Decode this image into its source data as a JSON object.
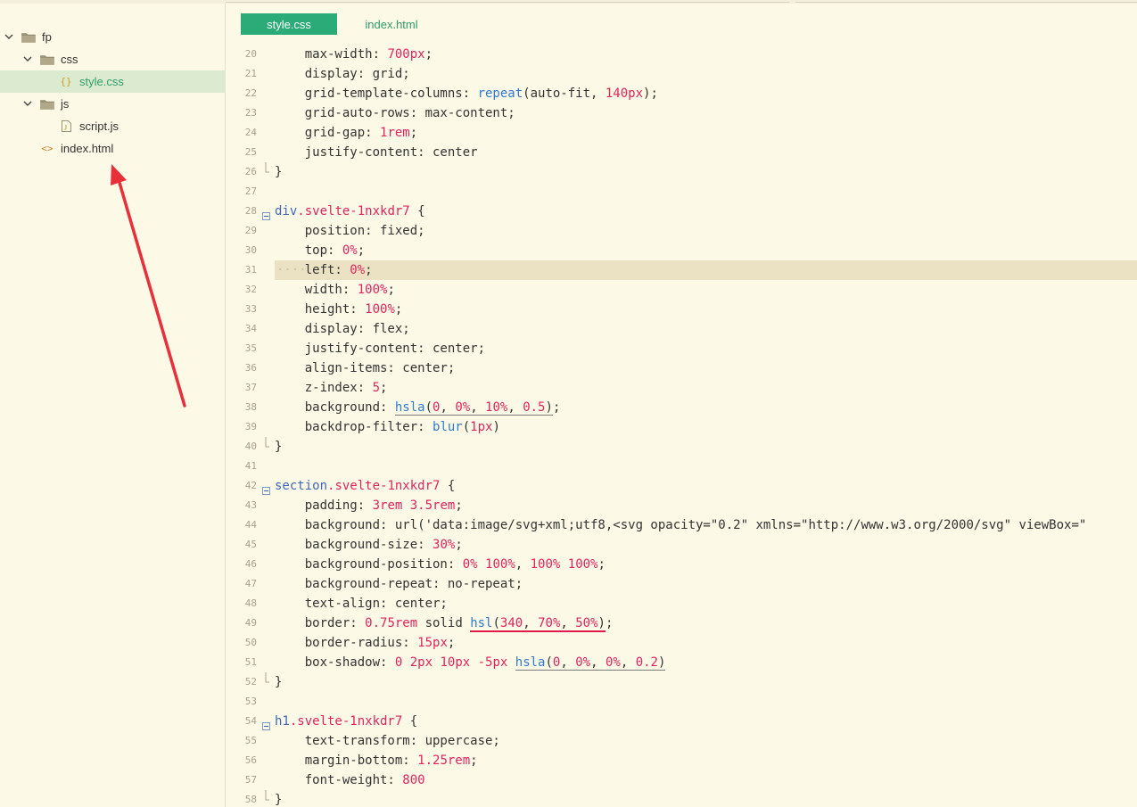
{
  "sidebar": {
    "items": [
      {
        "label": "fp",
        "kind": "folder",
        "expanded": true,
        "depth": 0,
        "selected": false
      },
      {
        "label": "css",
        "kind": "folder",
        "expanded": true,
        "depth": 1,
        "selected": false
      },
      {
        "label": "style.css",
        "kind": "css-file",
        "icon": "{}",
        "depth": 2,
        "selected": true
      },
      {
        "label": "js",
        "kind": "folder",
        "expanded": true,
        "depth": 1,
        "selected": false
      },
      {
        "label": "script.js",
        "kind": "js-file",
        "depth": 2,
        "selected": false
      },
      {
        "label": "index.html",
        "kind": "html-file",
        "icon": "<>",
        "depth": 1,
        "selected": false
      }
    ]
  },
  "tabs": [
    {
      "label": "style.css",
      "active": true
    },
    {
      "label": "index.html",
      "active": false
    }
  ],
  "colors": {
    "accent": "#2bab77",
    "selection_bg": "#dcebd0",
    "current_line": "#ebe1c3",
    "annotation_arrow": "#e8303a",
    "keyword_number": "#e0245e",
    "selector": "#3f67b9",
    "function": "#2f7bcf"
  },
  "editor": {
    "current_line": 31,
    "lines": [
      {
        "n": 20,
        "fold": "",
        "tokens": [
          [
            "    max-width: ",
            "p"
          ],
          [
            "700",
            "n"
          ],
          [
            "px",
            "n"
          ],
          [
            ";",
            "p"
          ]
        ]
      },
      {
        "n": 21,
        "fold": "",
        "tokens": [
          [
            "    display: grid;",
            "p"
          ]
        ]
      },
      {
        "n": 22,
        "fold": "",
        "tokens": [
          [
            "    grid-template-columns: ",
            "p"
          ],
          [
            "repeat",
            "f"
          ],
          [
            "(auto-fit, ",
            "p"
          ],
          [
            "140",
            "n"
          ],
          [
            "px",
            "n"
          ],
          [
            ");",
            "p"
          ]
        ]
      },
      {
        "n": 23,
        "fold": "",
        "tokens": [
          [
            "    grid-auto-rows: max-content;",
            "p"
          ]
        ]
      },
      {
        "n": 24,
        "fold": "",
        "tokens": [
          [
            "    grid-gap: ",
            "p"
          ],
          [
            "1",
            "n"
          ],
          [
            "rem",
            "n"
          ],
          [
            ";",
            "p"
          ]
        ]
      },
      {
        "n": 25,
        "fold": "",
        "tokens": [
          [
            "    justify-content: center",
            "p"
          ]
        ]
      },
      {
        "n": 26,
        "fold": "end",
        "tokens": [
          [
            "}",
            "p"
          ]
        ]
      },
      {
        "n": 27,
        "fold": "",
        "tokens": []
      },
      {
        "n": 28,
        "fold": "start",
        "tokens": [
          [
            "div",
            "s"
          ],
          [
            ".svelte-1nxkdr7",
            "c"
          ],
          [
            " {",
            "p"
          ]
        ]
      },
      {
        "n": 29,
        "fold": "",
        "tokens": [
          [
            "    position: fixed;",
            "p"
          ]
        ]
      },
      {
        "n": 30,
        "fold": "",
        "tokens": [
          [
            "    top: ",
            "p"
          ],
          [
            "0",
            "n"
          ],
          [
            "%",
            "n"
          ],
          [
            ";",
            "p"
          ]
        ]
      },
      {
        "n": 31,
        "fold": "",
        "tokens": [
          [
            "    left: ",
            "p"
          ],
          [
            "0",
            "n"
          ],
          [
            "%",
            "n"
          ],
          [
            ";",
            "p"
          ]
        ]
      },
      {
        "n": 32,
        "fold": "",
        "tokens": [
          [
            "    width: ",
            "p"
          ],
          [
            "100",
            "n"
          ],
          [
            "%",
            "n"
          ],
          [
            ";",
            "p"
          ]
        ]
      },
      {
        "n": 33,
        "fold": "",
        "tokens": [
          [
            "    height: ",
            "p"
          ],
          [
            "100",
            "n"
          ],
          [
            "%",
            "n"
          ],
          [
            ";",
            "p"
          ]
        ]
      },
      {
        "n": 34,
        "fold": "",
        "tokens": [
          [
            "    display: flex;",
            "p"
          ]
        ]
      },
      {
        "n": 35,
        "fold": "",
        "tokens": [
          [
            "    justify-content: center;",
            "p"
          ]
        ]
      },
      {
        "n": 36,
        "fold": "",
        "tokens": [
          [
            "    align-items: center;",
            "p"
          ]
        ]
      },
      {
        "n": 37,
        "fold": "",
        "tokens": [
          [
            "    z-index: ",
            "p"
          ],
          [
            "5",
            "n"
          ],
          [
            ";",
            "p"
          ]
        ]
      },
      {
        "n": 38,
        "fold": "",
        "tokens": [
          [
            "    background: ",
            "p"
          ],
          [
            "hsla",
            "fu"
          ],
          [
            "(",
            "pu"
          ],
          [
            "0",
            "nu"
          ],
          [
            ", ",
            "pu"
          ],
          [
            "0",
            "nu"
          ],
          [
            "%",
            "nu"
          ],
          [
            ", ",
            "pu"
          ],
          [
            "10",
            "nu"
          ],
          [
            "%",
            "nu"
          ],
          [
            ", ",
            "pu"
          ],
          [
            "0.5",
            "nu"
          ],
          [
            ")",
            "pu"
          ],
          [
            ";",
            "p"
          ]
        ]
      },
      {
        "n": 39,
        "fold": "",
        "tokens": [
          [
            "    backdrop-filter: ",
            "p"
          ],
          [
            "blur",
            "f"
          ],
          [
            "(",
            "p"
          ],
          [
            "1",
            "n"
          ],
          [
            "px",
            "n"
          ],
          [
            ")",
            "p"
          ]
        ]
      },
      {
        "n": 40,
        "fold": "end",
        "tokens": [
          [
            "}",
            "p"
          ]
        ]
      },
      {
        "n": 41,
        "fold": "",
        "tokens": []
      },
      {
        "n": 42,
        "fold": "start",
        "tokens": [
          [
            "section",
            "s"
          ],
          [
            ".svelte-1nxkdr7",
            "c"
          ],
          [
            " {",
            "p"
          ]
        ]
      },
      {
        "n": 43,
        "fold": "",
        "tokens": [
          [
            "    padding: ",
            "p"
          ],
          [
            "3",
            "n"
          ],
          [
            "rem ",
            "n"
          ],
          [
            "3.5",
            "n"
          ],
          [
            "rem",
            "n"
          ],
          [
            ";",
            "p"
          ]
        ]
      },
      {
        "n": 44,
        "fold": "",
        "tokens": [
          [
            "    background: url('data:image/svg+xml;utf8,<svg opacity=\"0.2\" xmlns=\"http://www.w3.org/2000/svg\" viewBox=\"",
            "p"
          ]
        ]
      },
      {
        "n": 45,
        "fold": "",
        "tokens": [
          [
            "    background-size: ",
            "p"
          ],
          [
            "30",
            "n"
          ],
          [
            "%",
            "n"
          ],
          [
            ";",
            "p"
          ]
        ]
      },
      {
        "n": 46,
        "fold": "",
        "tokens": [
          [
            "    background-position: ",
            "p"
          ],
          [
            "0",
            "n"
          ],
          [
            "% ",
            "n"
          ],
          [
            "100",
            "n"
          ],
          [
            "%",
            "n"
          ],
          [
            ", ",
            "p"
          ],
          [
            "100",
            "n"
          ],
          [
            "% ",
            "n"
          ],
          [
            "100",
            "n"
          ],
          [
            "%",
            "n"
          ],
          [
            ";",
            "p"
          ]
        ]
      },
      {
        "n": 47,
        "fold": "",
        "tokens": [
          [
            "    background-repeat: no-repeat;",
            "p"
          ]
        ]
      },
      {
        "n": 48,
        "fold": "",
        "tokens": [
          [
            "    text-align: center;",
            "p"
          ]
        ]
      },
      {
        "n": 49,
        "fold": "",
        "tokens": [
          [
            "    border: ",
            "p"
          ],
          [
            "0.75",
            "n"
          ],
          [
            "rem",
            "n"
          ],
          [
            " solid ",
            "p"
          ],
          [
            "hsl",
            "fr"
          ],
          [
            "(",
            "pr"
          ],
          [
            "340",
            "nr"
          ],
          [
            ", ",
            "pr"
          ],
          [
            "70",
            "nr"
          ],
          [
            "%",
            "nr"
          ],
          [
            ", ",
            "pr"
          ],
          [
            "50",
            "nr"
          ],
          [
            "%",
            "nr"
          ],
          [
            ")",
            "pr"
          ],
          [
            ";",
            "p"
          ]
        ]
      },
      {
        "n": 50,
        "fold": "",
        "tokens": [
          [
            "    border-radius: ",
            "p"
          ],
          [
            "15",
            "n"
          ],
          [
            "px",
            "n"
          ],
          [
            ";",
            "p"
          ]
        ]
      },
      {
        "n": 51,
        "fold": "",
        "tokens": [
          [
            "    box-shadow: ",
            "p"
          ],
          [
            "0 ",
            "n"
          ],
          [
            "2",
            "n"
          ],
          [
            "px ",
            "n"
          ],
          [
            "10",
            "n"
          ],
          [
            "px ",
            "n"
          ],
          [
            "-5",
            "n"
          ],
          [
            "px ",
            "n"
          ],
          [
            "hsla",
            "fu"
          ],
          [
            "(",
            "pu"
          ],
          [
            "0",
            "nu"
          ],
          [
            ", ",
            "pu"
          ],
          [
            "0",
            "nu"
          ],
          [
            "%",
            "nu"
          ],
          [
            ", ",
            "pu"
          ],
          [
            "0",
            "nu"
          ],
          [
            "%",
            "nu"
          ],
          [
            ", ",
            "pu"
          ],
          [
            "0.2",
            "nu"
          ],
          [
            ")",
            "pu"
          ]
        ]
      },
      {
        "n": 52,
        "fold": "end",
        "tokens": [
          [
            "}",
            "p"
          ]
        ]
      },
      {
        "n": 53,
        "fold": "",
        "tokens": []
      },
      {
        "n": 54,
        "fold": "start",
        "tokens": [
          [
            "h1",
            "s"
          ],
          [
            ".svelte-1nxkdr7",
            "c"
          ],
          [
            " {",
            "p"
          ]
        ]
      },
      {
        "n": 55,
        "fold": "",
        "tokens": [
          [
            "    text-transform: uppercase;",
            "p"
          ]
        ]
      },
      {
        "n": 56,
        "fold": "",
        "tokens": [
          [
            "    margin-bottom: ",
            "p"
          ],
          [
            "1.25",
            "n"
          ],
          [
            "rem",
            "n"
          ],
          [
            ";",
            "p"
          ]
        ]
      },
      {
        "n": 57,
        "fold": "",
        "tokens": [
          [
            "    font-weight: ",
            "p"
          ],
          [
            "800",
            "n"
          ]
        ]
      },
      {
        "n": 58,
        "fold": "end",
        "tokens": [
          [
            "}",
            "p"
          ]
        ]
      }
    ]
  }
}
